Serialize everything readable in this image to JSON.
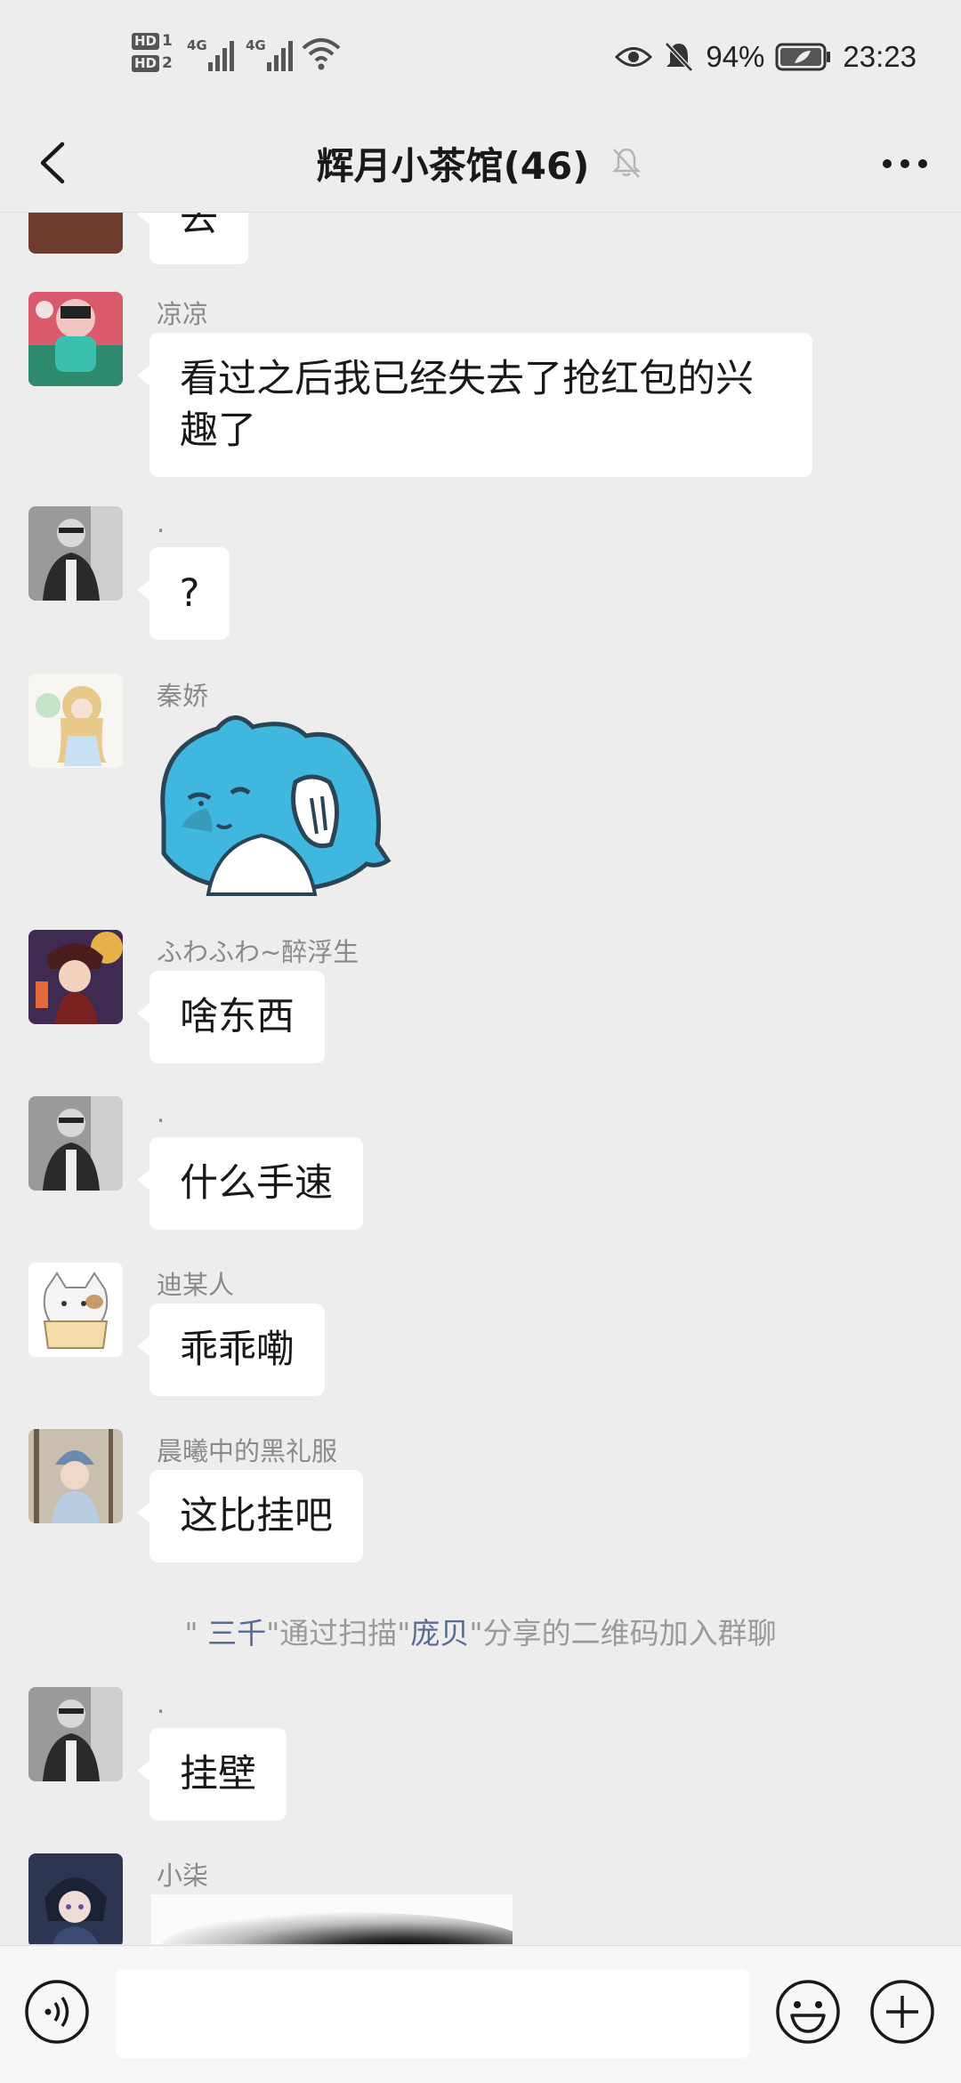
{
  "status_bar": {
    "hd1": "HD",
    "hd1_num": "1",
    "hd2": "HD",
    "hd2_num": "2",
    "net1": "4G",
    "net2": "4G",
    "battery": "94%",
    "time": "23:23"
  },
  "nav": {
    "title": "辉月小茶馆(46)",
    "back_icon": "chevron-left-icon",
    "mute_icon": "bell-off-icon",
    "more_icon": "more-dots-icon"
  },
  "messages": {
    "m0": {
      "text": "去"
    },
    "m1": {
      "sender": "凉凉",
      "text": "看过之后我已经失去了抢红包的兴趣了"
    },
    "m2": {
      "sender": ".",
      "text": "?"
    },
    "m3": {
      "sender": "秦娇",
      "sticker": "blue-cat-shark-sticker"
    },
    "m4": {
      "sender": "ふわふわ~醉浮生",
      "text": "啥东西"
    },
    "m5": {
      "sender": ".",
      "text": "什么手速"
    },
    "m6": {
      "sender": "迪某人",
      "text": "乖乖嘞"
    },
    "m7": {
      "sender": "晨曦中的黑礼服",
      "text": "这比挂吧"
    },
    "system": {
      "q1": "\" ",
      "name1": "三千",
      "mid": "\"通过扫描\"",
      "name2": "庞贝",
      "end": "\"分享的二维码加入群聊"
    },
    "m8": {
      "sender": ".",
      "text": "挂壁"
    },
    "m9": {
      "sender": "小柒",
      "image": "blurred-image"
    }
  },
  "input": {
    "voice_icon": "voice-icon",
    "emoji_icon": "emoji-icon",
    "plus_icon": "plus-icon",
    "placeholder": ""
  },
  "colors": {
    "background": "#ededed",
    "bubble": "#ffffff",
    "link": "#576b95",
    "sender": "#8a8a8a"
  }
}
